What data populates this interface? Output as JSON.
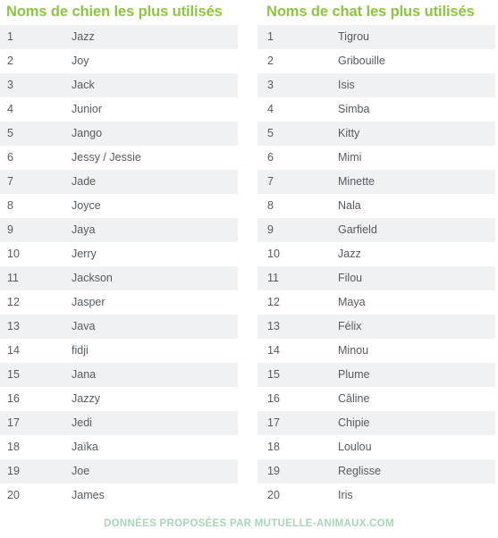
{
  "columns": [
    {
      "title": "Noms de chien les plus utilisés",
      "rows": [
        {
          "rank": "1",
          "name": "Jazz"
        },
        {
          "rank": "2",
          "name": "Joy"
        },
        {
          "rank": "3",
          "name": "Jack"
        },
        {
          "rank": "4",
          "name": "Junior"
        },
        {
          "rank": "5",
          "name": "Jango"
        },
        {
          "rank": "6",
          "name": "Jessy / Jessie"
        },
        {
          "rank": "7",
          "name": "Jade"
        },
        {
          "rank": "8",
          "name": "Joyce"
        },
        {
          "rank": "9",
          "name": "Jaya"
        },
        {
          "rank": "10",
          "name": "Jerry"
        },
        {
          "rank": "11",
          "name": "Jackson"
        },
        {
          "rank": "12",
          "name": "Jasper"
        },
        {
          "rank": "13",
          "name": "Java"
        },
        {
          "rank": "14",
          "name": "fidji"
        },
        {
          "rank": "15",
          "name": "Jana"
        },
        {
          "rank": "16",
          "name": "Jazzy"
        },
        {
          "rank": "17",
          "name": "Jedi"
        },
        {
          "rank": "18",
          "name": "Jaïka"
        },
        {
          "rank": "19",
          "name": "Joe"
        },
        {
          "rank": "20",
          "name": "James"
        }
      ]
    },
    {
      "title": "Noms de chat les plus utilisés",
      "rows": [
        {
          "rank": "1",
          "name": "Tigrou"
        },
        {
          "rank": "2",
          "name": "Gribouille"
        },
        {
          "rank": "3",
          "name": "Isis"
        },
        {
          "rank": "4",
          "name": "Simba"
        },
        {
          "rank": "5",
          "name": "Kitty"
        },
        {
          "rank": "6",
          "name": "Mimi"
        },
        {
          "rank": "7",
          "name": "Minette"
        },
        {
          "rank": "8",
          "name": "Nala"
        },
        {
          "rank": "9",
          "name": "Garfield"
        },
        {
          "rank": "10",
          "name": "Jazz"
        },
        {
          "rank": "11",
          "name": "Filou"
        },
        {
          "rank": "12",
          "name": "Maya"
        },
        {
          "rank": "13",
          "name": "Félix"
        },
        {
          "rank": "14",
          "name": "Minou"
        },
        {
          "rank": "15",
          "name": "Plume"
        },
        {
          "rank": "16",
          "name": "Câline"
        },
        {
          "rank": "17",
          "name": "Chipie"
        },
        {
          "rank": "18",
          "name": "Loulou"
        },
        {
          "rank": "19",
          "name": "Reglisse"
        },
        {
          "rank": "20",
          "name": "Iris"
        }
      ]
    }
  ],
  "footer": {
    "credit": "Données proposées par mutuelle-animaux.com"
  },
  "colors": {
    "title_green": "#8CC63F",
    "footer_green": "#A8D5B8",
    "row_stripe": "#F0F1F3",
    "text": "#555B61"
  }
}
